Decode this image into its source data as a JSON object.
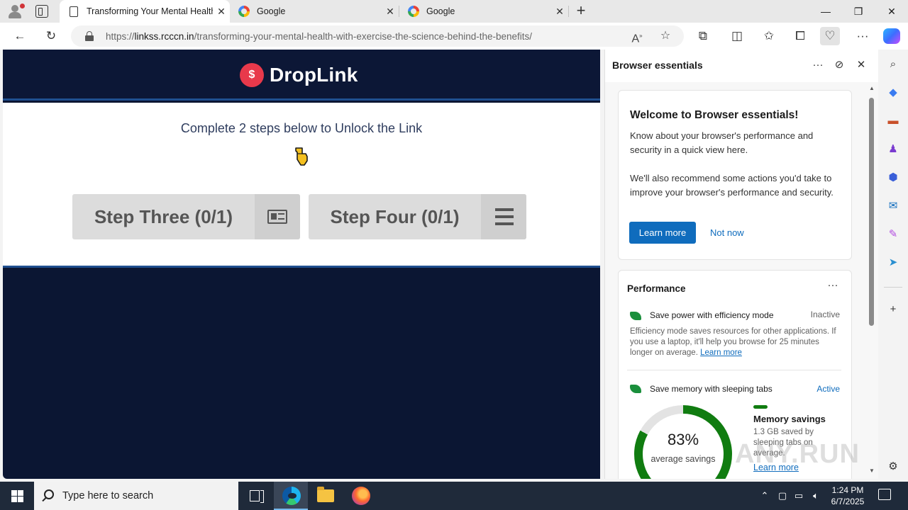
{
  "tabs": [
    {
      "title": "Transforming Your Mental Health with Exercise: The Science Behind the Benefits",
      "icon": "page-icon",
      "active": true
    },
    {
      "title": "Google",
      "icon": "google-icon",
      "active": false
    },
    {
      "title": "Google",
      "icon": "google-icon",
      "active": false
    }
  ],
  "address": {
    "prefix": "https://",
    "host": "linkss.rcccn.in",
    "path": "/transforming-your-mental-health-with-exercise-the-science-behind-the-benefits/"
  },
  "page": {
    "logo_text": "DropLink",
    "logo_mark": "$",
    "instruction": "Complete 2 steps below to Unlock the Link",
    "steps": [
      {
        "label": "Step Three (0/1)",
        "icon": "newspaper-icon"
      },
      {
        "label": "Step Four (0/1)",
        "icon": "list-icon"
      }
    ]
  },
  "panel": {
    "title": "Browser essentials",
    "welcome": {
      "heading": "Welcome to Browser essentials!",
      "para1": "Know about your browser's performance and security in a quick view here.",
      "para2": "We'll also recommend some actions you'd take to improve your browser's performance and security.",
      "learn_more": "Learn more",
      "not_now": "Not now"
    },
    "performance": {
      "title": "Performance",
      "efficiency_label": "Save power with efficiency mode",
      "efficiency_state": "Inactive",
      "efficiency_desc": "Efficiency mode saves resources for other applications. If you use a laptop, it'll help you browse for 25 minutes longer on average.",
      "efficiency_link": "Learn more",
      "sleeping_label": "Save memory with sleeping tabs",
      "sleeping_state": "Active",
      "savings_percent": "83%",
      "savings_sub": "average savings",
      "savings_fraction": 0.83,
      "memory_title": "Memory savings",
      "memory_desc": "1.3 GB saved by sleeping tabs on average.",
      "memory_link": "Learn more"
    }
  },
  "taskbar": {
    "search_placeholder": "Type here to search",
    "time": "1:24 PM",
    "date": "6/7/2025"
  },
  "watermark": "ANY.RUN",
  "colors": {
    "page_background": "#0b1633",
    "accent_blue": "#0f6cbd",
    "active_green": "#107c10",
    "logo_red": "#e8394b"
  }
}
